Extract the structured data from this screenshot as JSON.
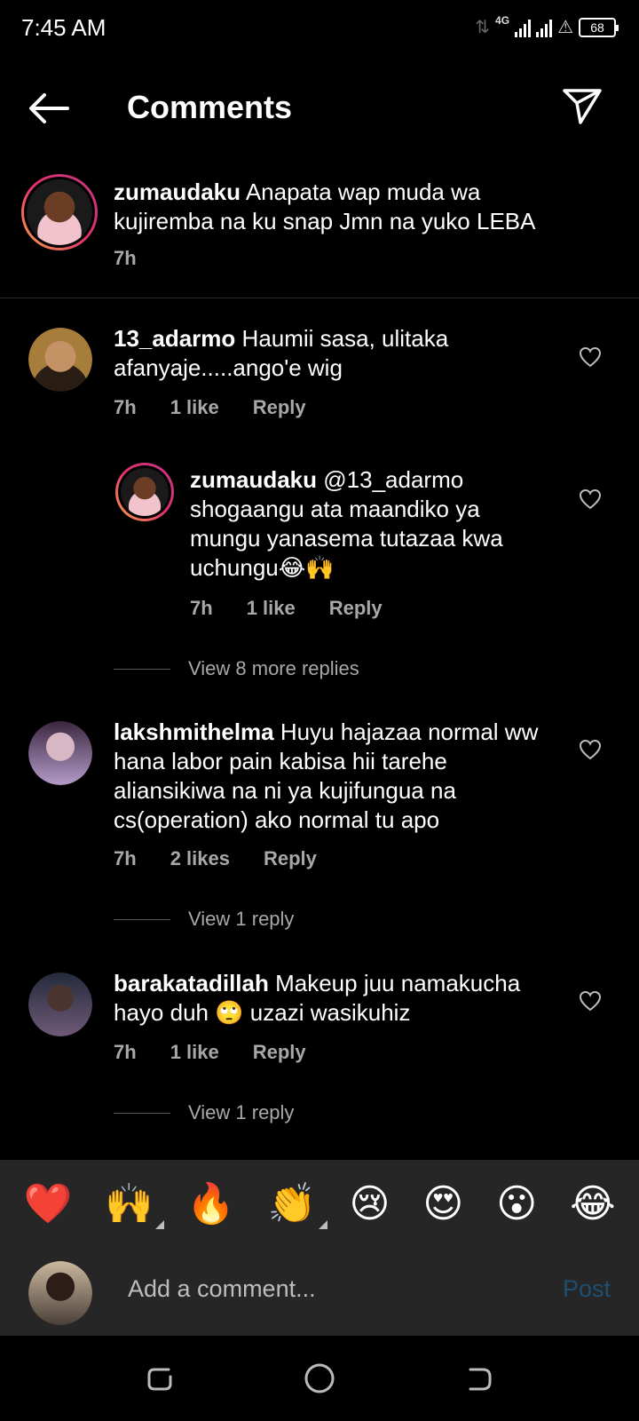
{
  "status_bar": {
    "time": "7:45 AM",
    "network": "4G",
    "battery": "68"
  },
  "header": {
    "title": "Comments",
    "back_icon": "arrow-left-icon",
    "share_icon": "paper-plane-icon"
  },
  "caption": {
    "username": "zumaudaku",
    "text": "Anapata wap muda wa kujiremba na ku snap Jmn na yuko LEBA",
    "time": "7h"
  },
  "comments": [
    {
      "username": "13_adarmo",
      "text": "Haumii sasa, ulitaka afanyaje.....ango'e wig",
      "time": "7h",
      "likes": "1 like",
      "reply_label": "Reply"
    },
    {
      "username": "zumaudaku",
      "text": "@13_adarmo shogaangu ata maandiko ya mungu yanasema tutazaa kwa uchungu😂🙌",
      "time": "7h",
      "likes": "1 like",
      "reply_label": "Reply"
    },
    {
      "username": "lakshmithelma",
      "text": "Huyu hajazaa normal ww hana labor pain kabisa hii tarehe aliansikiwa na ni ya kujifungua na cs(operation) ako normal tu apo",
      "time": "7h",
      "likes": "2 likes",
      "reply_label": "Reply"
    },
    {
      "username": "barakatadillah",
      "text": "Makeup juu namakucha hayo duh 🙄  uzazi wasikuhiz",
      "time": "7h",
      "likes": "1 like",
      "reply_label": "Reply"
    }
  ],
  "view_more": [
    "View 8 more replies",
    "View 1 reply",
    "View 1 reply"
  ],
  "emoji_bar": [
    "❤️",
    "🙌",
    "🔥",
    "👏",
    "😢",
    "😍",
    "😮",
    "😂"
  ],
  "composer": {
    "placeholder": "Add a comment...",
    "post_label": "Post"
  },
  "colors": {
    "background": "#000000",
    "muted_text": "#a8a8a8",
    "post_disabled": "#1d4f73",
    "panel": "#262626"
  }
}
